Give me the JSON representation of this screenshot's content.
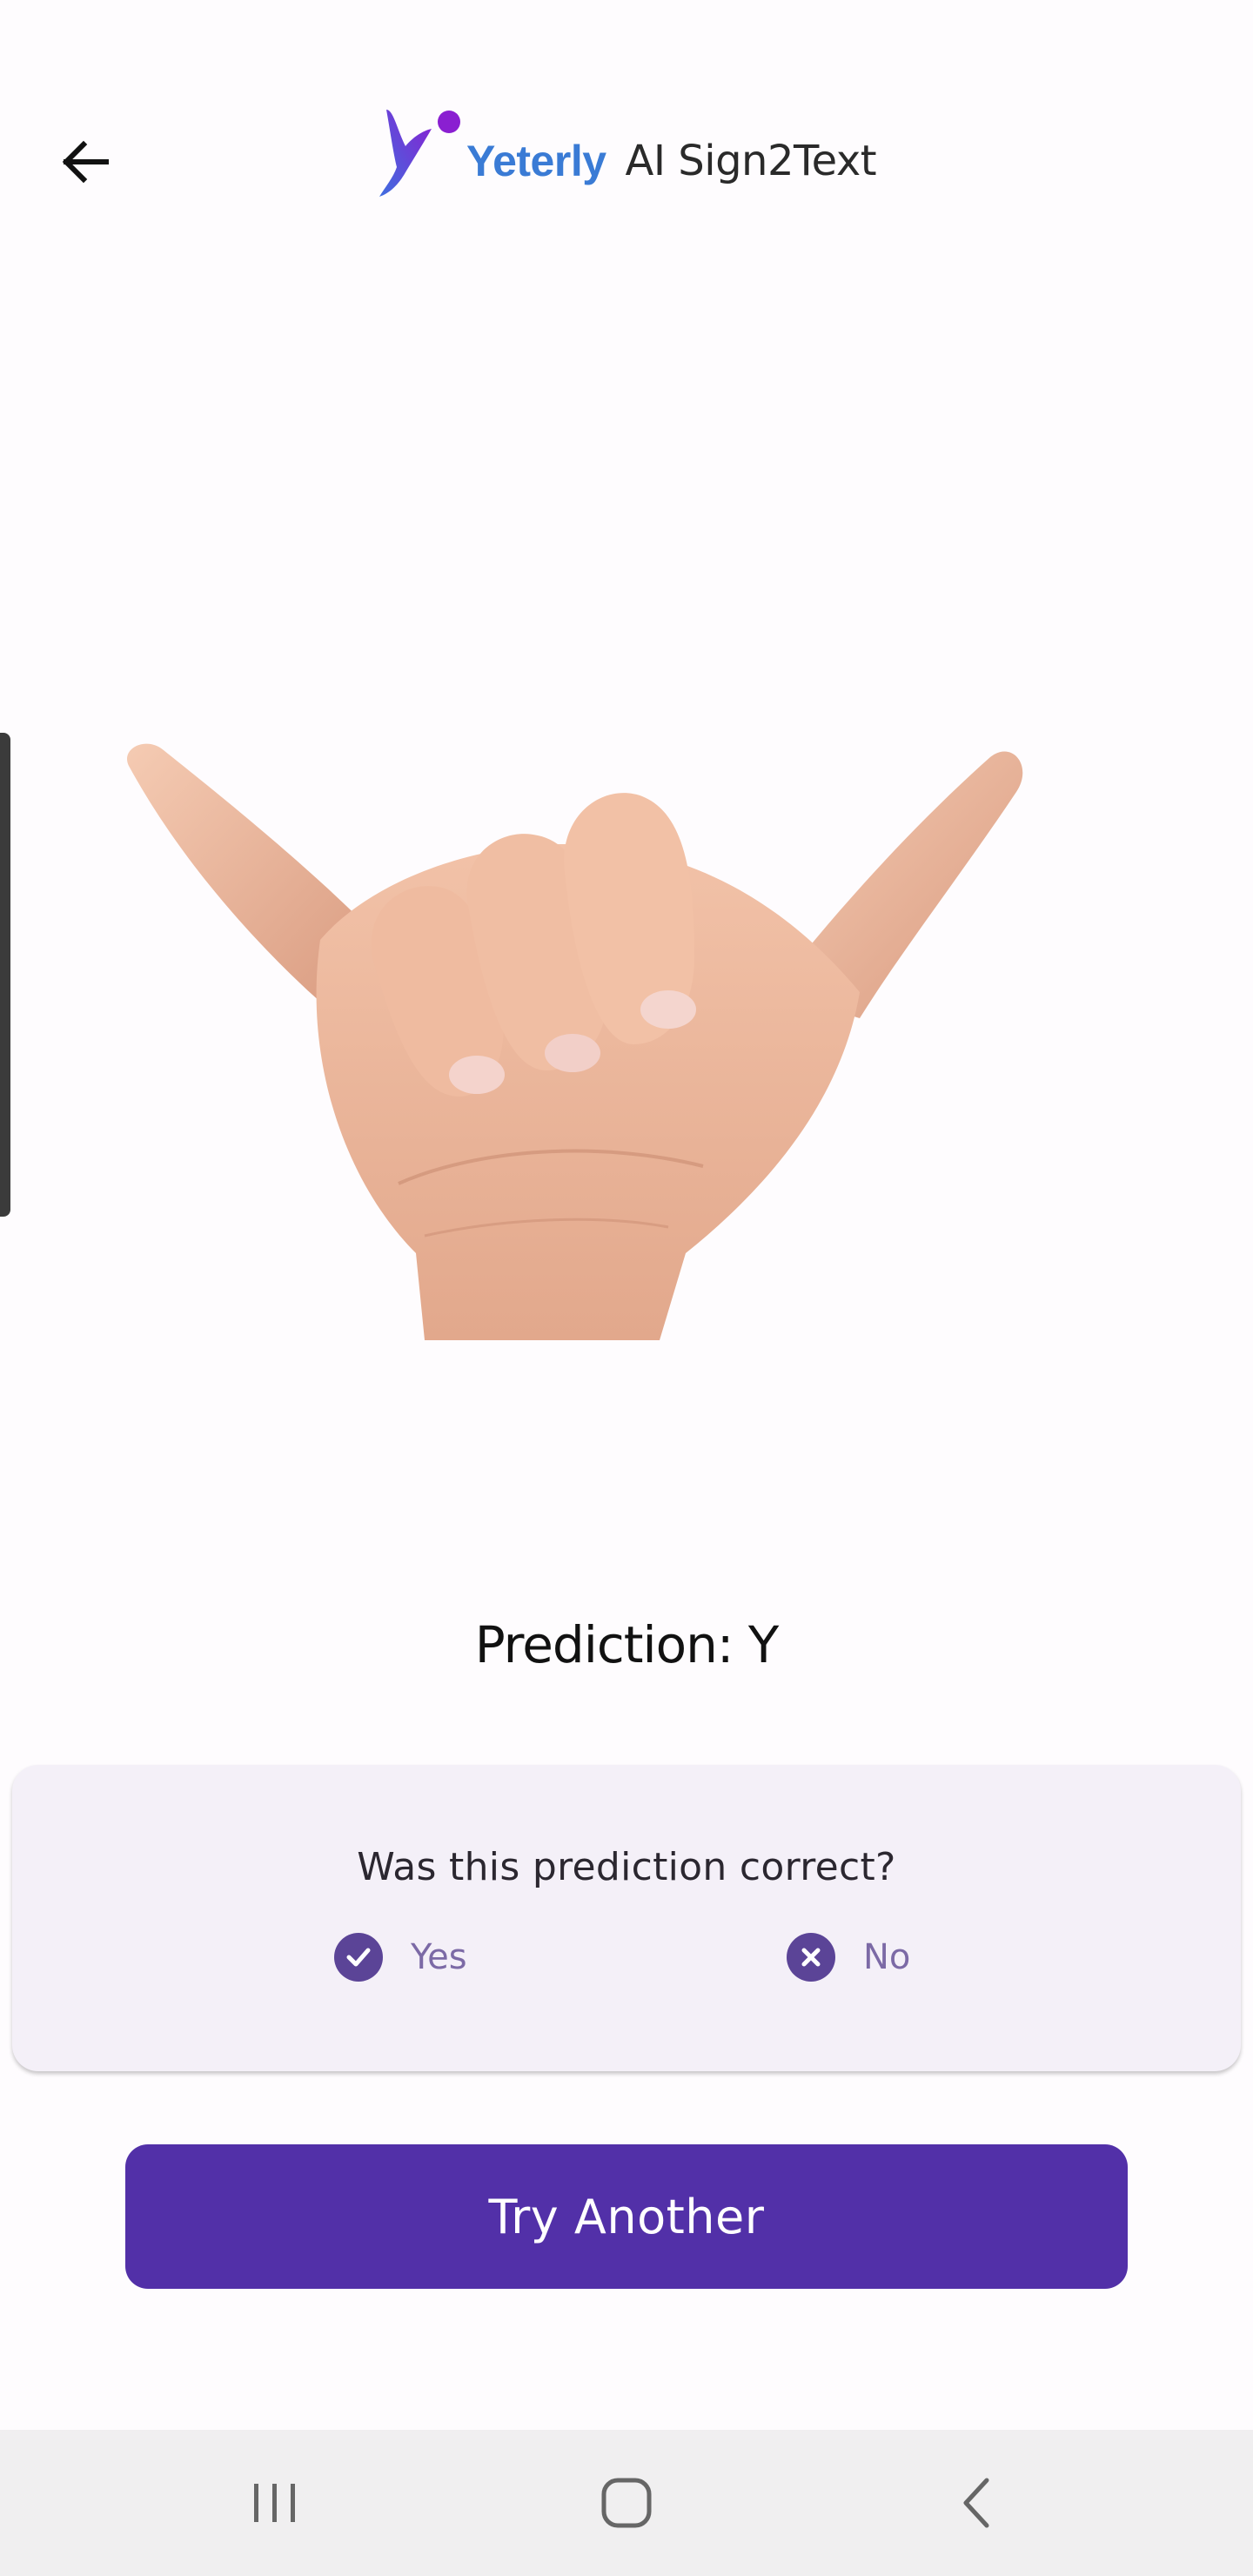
{
  "header": {
    "brand": "Yeterly",
    "product": "AI Sign2Text",
    "logo_icon": "yeterly-logo-icon",
    "back_icon": "arrow-left-icon"
  },
  "sign_image": {
    "icon": "hand-sign-y-image"
  },
  "prediction": {
    "text": "Prediction: Y"
  },
  "feedback": {
    "question": "Was this prediction correct?",
    "yes_label": "Yes",
    "no_label": "No",
    "yes_icon": "check-circle-icon",
    "no_icon": "x-circle-icon"
  },
  "actions": {
    "try_another_label": "Try Another"
  },
  "nav": {
    "recents_icon": "recent-apps-icon",
    "home_icon": "home-icon",
    "back_icon": "nav-back-icon"
  },
  "colors": {
    "accent": "#5230a8",
    "card_bg": "#f4f0f8",
    "choice_icon": "#5b4497",
    "brand_blue": "#3a7bd5",
    "brand_purple": "#8a1fd1"
  }
}
